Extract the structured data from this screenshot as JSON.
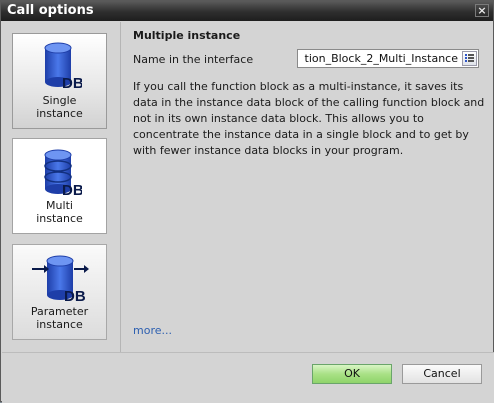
{
  "window": {
    "title": "Call options",
    "close_glyph": "×"
  },
  "options": [
    {
      "label_line1": "Single",
      "label_line2": "instance",
      "icon": "db-single-icon"
    },
    {
      "label_line1": "Multi",
      "label_line2": "instance",
      "icon": "db-multi-icon"
    },
    {
      "label_line1": "Parameter",
      "label_line2": "instance",
      "icon": "db-parameter-icon"
    }
  ],
  "db_text": "DB",
  "detail": {
    "title": "Multiple instance",
    "name_label": "Name in the interface",
    "name_value": "tion_Block_2_Multi_Instance",
    "description": "If you call the function block as a multi-instance, it saves its data in the instance data block of the calling function block and not in its own instance data block. This allows you to concentrate the instance data in a single block and to get by with fewer instance data blocks in your program.",
    "more_link": "more..."
  },
  "buttons": {
    "ok": "OK",
    "cancel": "Cancel"
  },
  "colors": {
    "db_blue": "#2f56c9",
    "ok_green": "#a9e186",
    "title_bar": "#2e2e2e"
  }
}
